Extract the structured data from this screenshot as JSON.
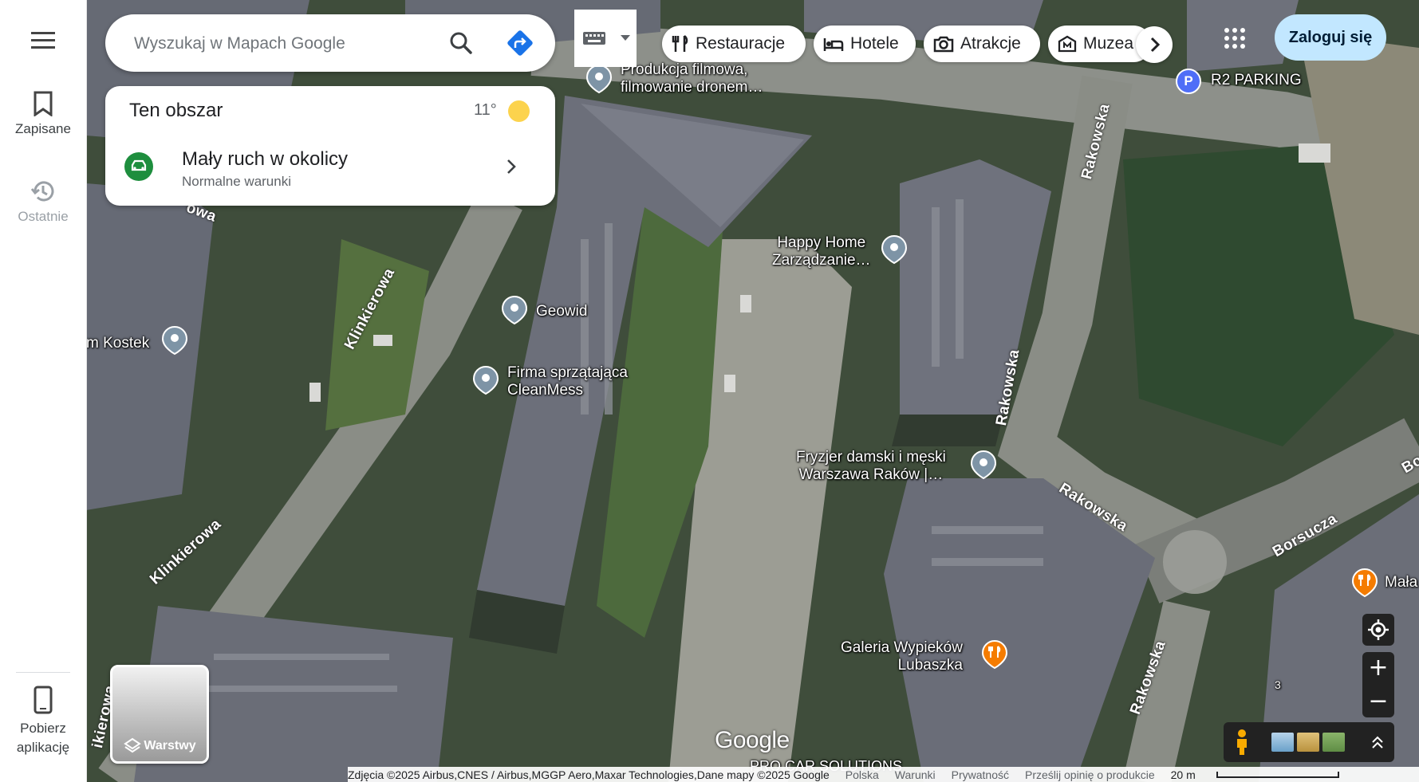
{
  "rail": {
    "saved_label": "Zapisane",
    "recent_label": "Ostatnie",
    "get_app_label_1": "Pobierz",
    "get_app_label_2": "aplikację"
  },
  "search": {
    "placeholder": "Wyszukaj w Mapach Google"
  },
  "chips": [
    {
      "label": "Restauracje",
      "icon": "fork-knife-icon"
    },
    {
      "label": "Hotele",
      "icon": "bed-icon"
    },
    {
      "label": "Atrakcje",
      "icon": "camera-icon"
    },
    {
      "label": "Muzea",
      "icon": "museum-icon"
    }
  ],
  "header": {
    "signin_label": "Zaloguj się"
  },
  "area_card": {
    "title": "Ten obszar",
    "temperature": "11°",
    "traffic_title": "Mały ruch w okolicy",
    "traffic_subtitle": "Normalne warunki"
  },
  "places": {
    "produkcja_1": "Produkcja filmowa,",
    "produkcja_2": "filmowanie dronem…",
    "r2_parking": "R2 PARKING",
    "parking_badge": "P",
    "happy_1": "Happy Home",
    "happy_2": "Zarządzanie…",
    "geowid": "Geowid",
    "kostek": "m Kostek",
    "clean_1": "Firma sprzątająca",
    "clean_2": "CleanMess",
    "fryzjer_1": "Fryzjer damski i męski",
    "fryzjer_2": "Warszawa Raków |…",
    "galeria_1": "Galeria Wypieków",
    "galeria_2": "Lubaszka",
    "mala": "Mała",
    "procar": "PRO CAR SOLUTIONS",
    "number_3": "3"
  },
  "streets": {
    "rakowska": "Rakowska",
    "klinkierowa": "Klinkierowa",
    "klinkierowa_partial": "ikierowa",
    "borsucza": "Borsucza",
    "bo": "Bo",
    "owa_partial": "owa"
  },
  "layers": {
    "label": "Warstwy"
  },
  "map_controls": {
    "zoom_in": "+",
    "zoom_out": "−"
  },
  "logo": "Google",
  "footer": {
    "attribution": "Zdjęcia ©2025 Airbus,CNES / Airbus,MGGP Aero,Maxar Technologies,Dane mapy ©2025 Google",
    "country": "Polska",
    "terms": "Warunki",
    "privacy": "Prywatność",
    "feedback": "Prześlij opinię o produkcie",
    "scale": "20 m"
  },
  "colors": {
    "signin_bg": "#c2e7ff",
    "directions_blue": "#1a73e8",
    "traffic_green": "#1e8e3e",
    "restaurant_orange": "#f57c00",
    "parking_blue": "#4f6ef7"
  }
}
